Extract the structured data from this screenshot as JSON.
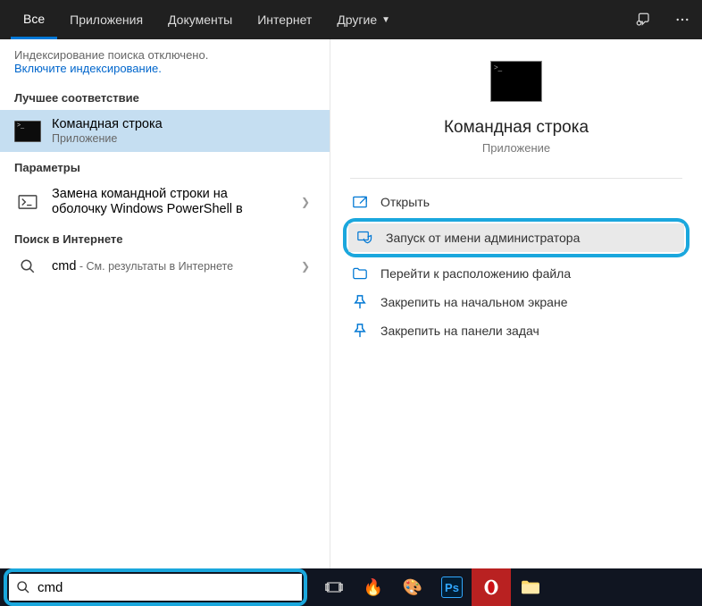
{
  "tabs": {
    "all": "Все",
    "apps": "Приложения",
    "documents": "Документы",
    "internet": "Интернет",
    "other": "Другие"
  },
  "indexing": {
    "message": "Индексирование поиска отключено.",
    "link": "Включите индексирование."
  },
  "sections": {
    "bestMatch": "Лучшее соответствие",
    "settings": "Параметры",
    "webSearch": "Поиск в Интернете"
  },
  "results": {
    "cmd": {
      "title": "Командная строка",
      "subtitle": "Приложение"
    },
    "powershell": {
      "line1": "Замена командной строки на",
      "line2": "оболочку Windows PowerShell в"
    },
    "web": {
      "query": "cmd",
      "sep": " - ",
      "hint": "См. результаты в Интернете"
    }
  },
  "preview": {
    "title": "Командная строка",
    "subtitle": "Приложение"
  },
  "actions": {
    "open": "Открыть",
    "runAdmin": "Запуск от имени администратора",
    "openLocation": "Перейти к расположению файла",
    "pinStart": "Закрепить на начальном экране",
    "pinTaskbar": "Закрепить на панели задач"
  },
  "searchBox": {
    "value": "cmd",
    "placeholder": ""
  },
  "colors": {
    "accent": "#0078d7",
    "callout": "#1aa7dd"
  },
  "taskbarApps": [
    "task-view",
    "fire-app",
    "paint-app",
    "photoshop",
    "opera",
    "file-explorer"
  ]
}
